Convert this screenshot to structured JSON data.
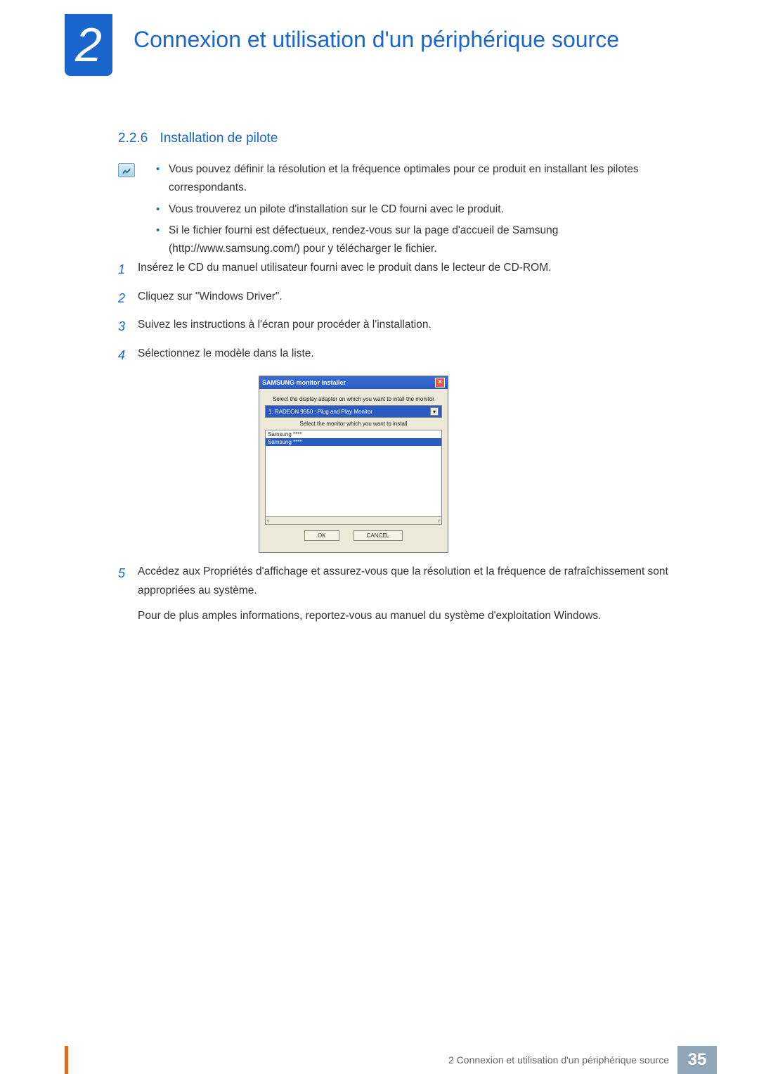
{
  "chapter": {
    "number": "2",
    "title": "Connexion et utilisation d'un périphérique source"
  },
  "section": {
    "number": "2.2.6",
    "title": "Installation de pilote"
  },
  "notes": [
    "Vous pouvez définir la résolution et la fréquence optimales pour ce produit en installant les pilotes correspondants.",
    "Vous trouverez un pilote d'installation sur le CD fourni avec le produit.",
    "Si le fichier fourni est défectueux, rendez-vous sur la page d'accueil de Samsung (http://www.samsung.com/) pour y télécharger le fichier."
  ],
  "steps": {
    "s1": {
      "num": "1",
      "text": "Insérez le CD du manuel utilisateur fourni avec le produit dans le lecteur de CD-ROM."
    },
    "s2": {
      "num": "2",
      "text": "Cliquez sur \"Windows Driver\"."
    },
    "s3": {
      "num": "3",
      "text": "Suivez les instructions à l'écran pour procéder à l'installation."
    },
    "s4": {
      "num": "4",
      "text": "Sélectionnez le modèle dans la liste."
    },
    "s5": {
      "num": "5",
      "text": "Accédez aux Propriétés d'affichage et assurez-vous que la résolution et la fréquence de rafraîchissement sont appropriées au système."
    },
    "s5b": "Pour de plus amples informations, reportez-vous au manuel du système d'exploitation Windows."
  },
  "installer": {
    "title": "SAMSUNG monitor installer",
    "label1": "Select the display adapter on which you want to intall the monitor",
    "select_value": "1. RADEON 9550 : Plug and Play Monitor",
    "label2": "Select the monitor which you want to install",
    "row1": "Samsung ****",
    "row2": "Samsung ****",
    "ok": "OK",
    "cancel": "CANCEL"
  },
  "footer": {
    "text": "2 Connexion et utilisation d'un périphérique source",
    "page": "35"
  }
}
